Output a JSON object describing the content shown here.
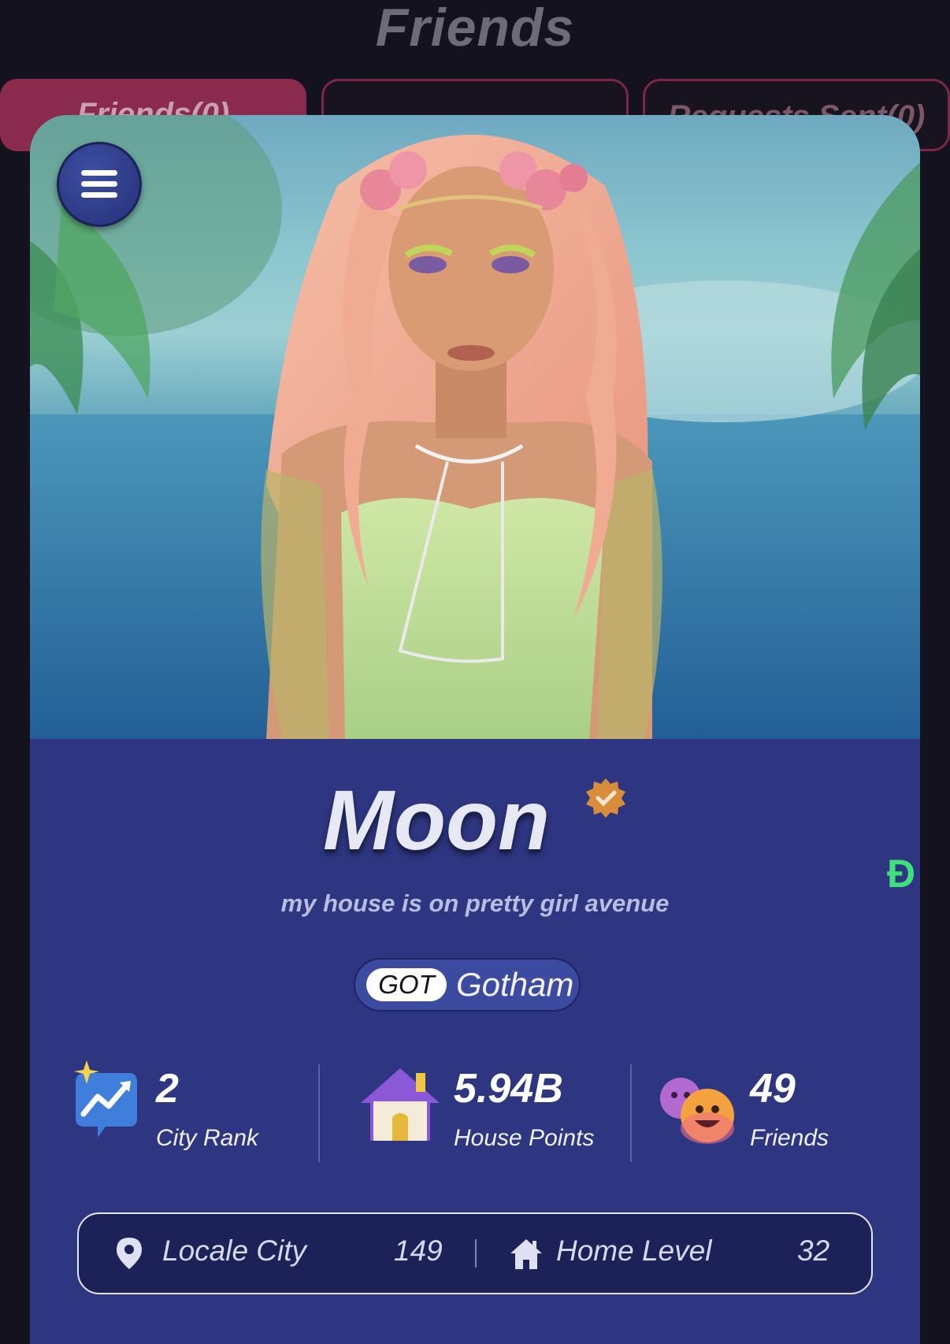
{
  "header": {
    "title": "Friends"
  },
  "tabs": [
    {
      "label": "Friends(0)",
      "active": true
    },
    {
      "label": "",
      "active": false
    },
    {
      "label": "Requests Sent(0)",
      "active": false
    }
  ],
  "menu": {
    "icon": "hamburger-menu-icon"
  },
  "profile": {
    "name": "Moon",
    "verified_icon": "verified-badge-icon",
    "bio": "my house is on pretty girl avenue",
    "city": {
      "code": "GOT",
      "name": "Gotham"
    }
  },
  "stats": [
    {
      "value": "2",
      "label": "City Rank",
      "icon": "trending-chart-icon"
    },
    {
      "value": "5.94B",
      "label": "House Points",
      "icon": "house-icon"
    },
    {
      "value": "49",
      "label": "Friends",
      "icon": "smiley-faces-icon"
    }
  ],
  "info": {
    "locale_label": "Locale City",
    "locale_value": "149",
    "home_label": "Home Level",
    "home_value": "32"
  },
  "side_glyph": "Đ",
  "colors": {
    "background": "#14121f",
    "card": "#2e3682",
    "active_tab": "#8a2a4c",
    "verified": "#d98d3a"
  }
}
